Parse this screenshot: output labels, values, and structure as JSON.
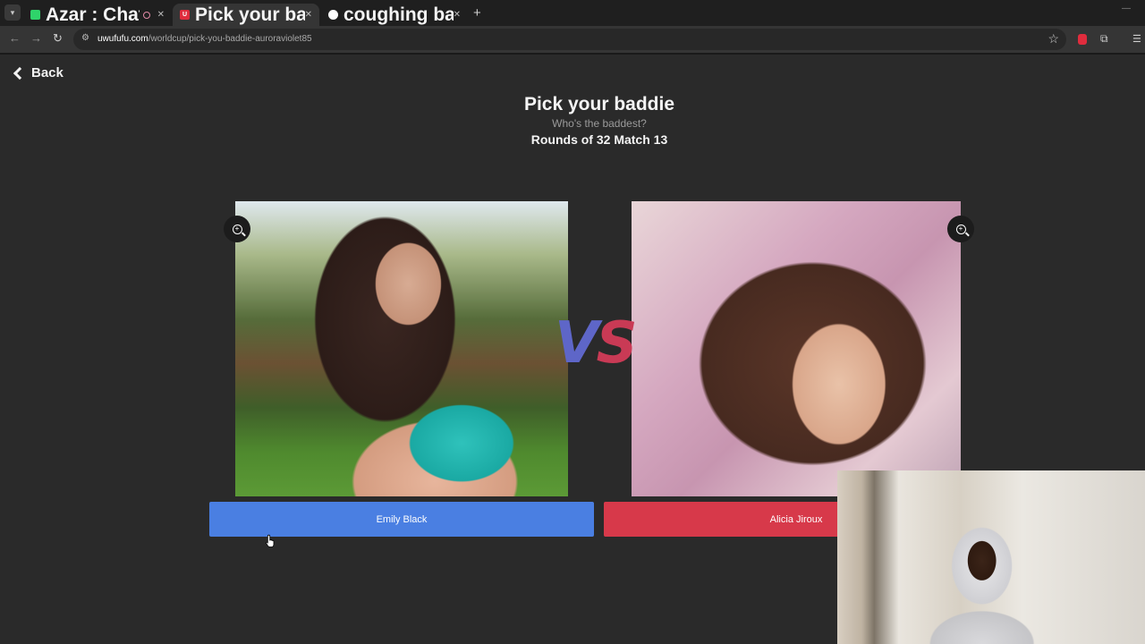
{
  "browser": {
    "tabs": [
      {
        "title": "Azar : Chat vidéo avec de n",
        "favicon_color": "#2fd46a",
        "active": false
      },
      {
        "title": "Pick your baddie | UwUFUFU",
        "favicon_color": "#e02c3d",
        "favicon_letter": "U",
        "active": true
      },
      {
        "title": "coughing baby vs hydrogen bo",
        "favicon_color": "#ffffff",
        "active": false
      }
    ],
    "close_glyph": "✕",
    "new_tab_glyph": "+",
    "url_host": "uwufufu.com",
    "url_path": "/worldcup/pick-you-baddie-auroraviolet85"
  },
  "page": {
    "back_label": "Back",
    "title": "Pick your baddie",
    "subtitle": "Who's the baddest?",
    "round_info": "Rounds of 32 Match 13",
    "vs_left": "V",
    "vs_right": "S",
    "zoom_glyph": "+",
    "left_choice": {
      "name": "Emily Black",
      "color": "#4a7fe2"
    },
    "right_choice": {
      "name": "Alicia Jiroux",
      "color": "#d7394a"
    }
  }
}
